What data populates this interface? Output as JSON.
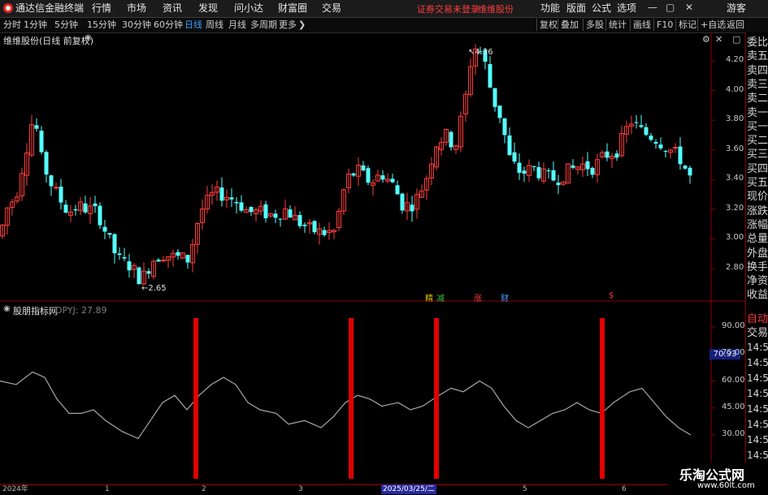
{
  "app": {
    "title": "通达信金融终端"
  },
  "menu": [
    "行情",
    "市场",
    "资讯",
    "发现",
    "问小达",
    "财富圈",
    "交易"
  ],
  "notice": "证券交易未登录",
  "stock_name": "维维股份",
  "right_menu": [
    "功能",
    "版面",
    "公式",
    "选项"
  ],
  "guest": "游客",
  "periods": [
    "分时",
    "1分钟",
    "5分钟",
    "15分钟",
    "30分钟",
    "60分钟",
    "日线",
    "周线",
    "月线",
    "多周期",
    "更多"
  ],
  "toolbar_buttons": [
    "复权",
    "叠加",
    "多股",
    "统计",
    "画线",
    "F10",
    "标记",
    "+自选",
    "返回"
  ],
  "main_title": "维维股份(日线 前复权)",
  "indicator": {
    "name": "股朋指标网",
    "label": "DPYJ: 27.89",
    "current": "70.93"
  },
  "price_axis": [
    "4.20",
    "4.00",
    "3.80",
    "3.60",
    "3.40",
    "3.20",
    "3.00",
    "2.80"
  ],
  "ind_axis": [
    "90.00",
    "75.00",
    "60.00",
    "45.00",
    "30.00"
  ],
  "markers": {
    "high": "4.36",
    "low": "2.65"
  },
  "news_flags": [
    {
      "text": "精",
      "color": "#e0c000"
    },
    {
      "text": "减",
      "color": "#3cc03c"
    },
    {
      "text": "涨",
      "color": "#ff3c3c"
    },
    {
      "text": "财",
      "color": "#4aa0ff"
    },
    {
      "text": "$",
      "color": "#ff3c3c"
    }
  ],
  "dates": [
    "2024年",
    "1",
    "2",
    "3",
    "2025/03/25/二",
    "5",
    "6"
  ],
  "quote_panel": [
    "委比",
    "卖五",
    "卖四",
    "卖三",
    "卖二",
    "卖一",
    "买一",
    "买二",
    "买三",
    "买四",
    "买五",
    "现价",
    "涨跌",
    "涨幅",
    "总量",
    "外盘",
    "换手",
    "净资",
    "收益"
  ],
  "side_panel": {
    "auto": "自动",
    "trade": "交易",
    "times": [
      "14:56",
      "14:56",
      "14:56",
      "14:56",
      "14:56",
      "14:56",
      "14:5",
      "14:5"
    ]
  },
  "watermark": {
    "line1": "乐淘公式网",
    "line2": "www.60lt.com"
  },
  "colors": {
    "up": "#ff3c3c",
    "down": "#54ffff",
    "grid": "#8b0000",
    "signal": "#e00000",
    "ind_line": "#a8a8a8"
  }
}
